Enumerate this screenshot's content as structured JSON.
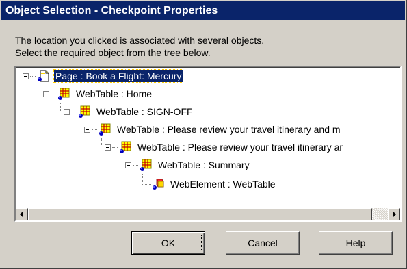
{
  "window": {
    "title": "Object Selection - Checkpoint Properties"
  },
  "description": {
    "line1": "The location you clicked is associated with several objects.",
    "line2": "Select the required object from the tree below."
  },
  "tree": {
    "items": [
      {
        "label": "Page : Book a Flight: Mercury",
        "icon": "page-icon",
        "selected": true,
        "expanded": true
      },
      {
        "label": "WebTable : Home",
        "icon": "webtable-icon",
        "expanded": true
      },
      {
        "label": "WebTable : SIGN-OFF",
        "icon": "webtable-icon",
        "expanded": true
      },
      {
        "label": "WebTable : Please review your travel itinerary and m",
        "icon": "webtable-icon",
        "expanded": true
      },
      {
        "label": "WebTable : Please review your travel itinerary ar",
        "icon": "webtable-icon",
        "expanded": true
      },
      {
        "label": "WebTable : Summary",
        "icon": "webtable-icon",
        "expanded": true
      },
      {
        "label": "WebElement : WebTable",
        "icon": "webelement-icon"
      }
    ]
  },
  "buttons": {
    "ok": "OK",
    "cancel": "Cancel",
    "help": "Help"
  },
  "colors": {
    "titlebar": "#0a246a",
    "dialog": "#d4d0c8",
    "selection": "#0a246a"
  }
}
